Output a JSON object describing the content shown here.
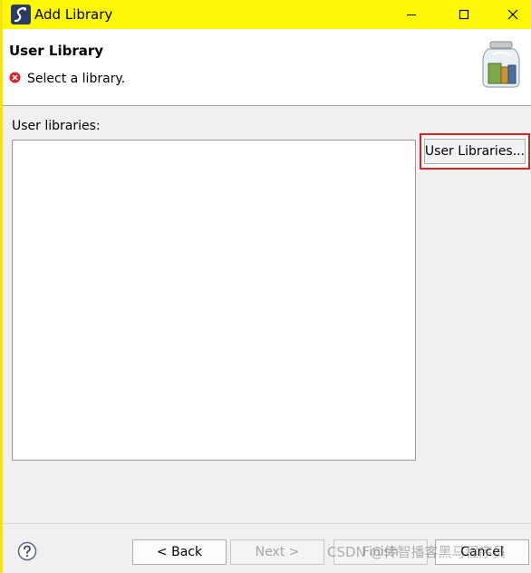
{
  "window": {
    "title": "Add Library",
    "titlebar_color": "#fef806"
  },
  "banner": {
    "title": "User Library",
    "message": "Select a library.",
    "status_icon": "error-icon",
    "decor_icon": "library-jar-icon"
  },
  "body": {
    "list_label": "User libraries:",
    "list_items": [],
    "user_libraries_button": "User Libraries...",
    "highlight_color": "#e02020"
  },
  "footer": {
    "help_icon": "help-icon",
    "back_label": "< Back",
    "next_label": "Next >",
    "finish_label": "Finish",
    "cancel_label": "Cancel"
  },
  "watermark": "CSDN @传智播客黑马程序员"
}
